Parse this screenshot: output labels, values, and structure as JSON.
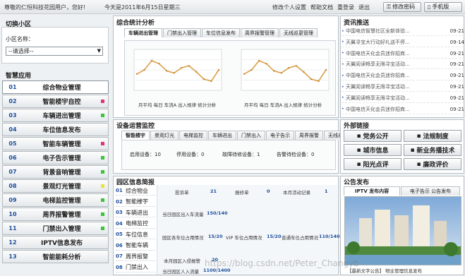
{
  "topbar": {
    "welcome": "尊敬的仁恒科技花园用户，您好!",
    "date": "今天是2011年6月15日星期三",
    "links": [
      "修改个人设置",
      "帮助文档",
      "重登录",
      "退出"
    ],
    "btn_password": "修改密码",
    "btn_mobile": "手机版"
  },
  "left": {
    "title_switch": "切换小区",
    "community_label": "小区名称：",
    "community_select": "--请选择--",
    "title_apps": "智慧应用",
    "menu": [
      {
        "num": "01",
        "label": "综合物业管理",
        "dot": ""
      },
      {
        "num": "02",
        "label": "智能楼宇自控",
        "dot": "#e0337a"
      },
      {
        "num": "03",
        "label": "车辆进出管理",
        "dot": "#39c43a"
      },
      {
        "num": "04",
        "label": "车位信息发布",
        "dot": ""
      },
      {
        "num": "05",
        "label": "智能车辆管理",
        "dot": "#e0337a"
      },
      {
        "num": "06",
        "label": "电子告示管理",
        "dot": "#39c43a"
      },
      {
        "num": "07",
        "label": "背景音响管理",
        "dot": "#39c43a"
      },
      {
        "num": "08",
        "label": "景观灯光管理",
        "dot": "#e8e23a"
      },
      {
        "num": "09",
        "label": "电梯监控管理",
        "dot": "#39c43a"
      },
      {
        "num": "10",
        "label": "周界报警管理",
        "dot": "#39c43a"
      },
      {
        "num": "11",
        "label": "门禁出入管理",
        "dot": "#39c43a"
      },
      {
        "num": "12",
        "label": "IPTV信息发布",
        "dot": ""
      },
      {
        "num": "13",
        "label": "智能能耗分析",
        "dot": ""
      }
    ]
  },
  "stats": {
    "title": "综合统计分析",
    "tabs": [
      "车辆进出管理",
      "门禁出入管理",
      "车位信息发布",
      "周界报警管理",
      "无线巡更管理"
    ],
    "captions": [
      "月平均 每日 车流A 出入规律 统计分析",
      "月平均 每日 车流A 出入规律 统计分析"
    ]
  },
  "devices": {
    "title": "设备运营监控",
    "tabs": [
      "智能楼宇",
      "景观灯光",
      "电梯监控",
      "车辆进出",
      "门禁出入",
      "电子告示",
      "周界报警",
      "无线巡更"
    ],
    "row": [
      {
        "label": "启用设备：",
        "value": "10"
      },
      {
        "label": "停用设备：",
        "value": "0"
      },
      {
        "label": "故障待修设备：",
        "value": "1"
      },
      {
        "label": "告警待检设备：",
        "value": "0"
      }
    ]
  },
  "briefs": {
    "title": "园区信息简报",
    "rows": [
      {
        "num": "01",
        "label": "综合物业"
      },
      {
        "num": "02",
        "label": "智能楼宇"
      },
      {
        "num": "03",
        "label": "车辆进出"
      },
      {
        "num": "04",
        "label": "电梯监控"
      },
      {
        "num": "05",
        "label": "车位信息"
      },
      {
        "num": "06",
        "label": "智能车辆"
      },
      {
        "num": "07",
        "label": "周界报警"
      },
      {
        "num": "08",
        "label": "门禁出入"
      }
    ],
    "stats": {
      "s1": "投诉单",
      "v1": "21",
      "s2": "报修单",
      "v2": "0",
      "s3": "本月活动记录",
      "v3": "1",
      "s4": "当日园区出入车流量",
      "v4": "150/140",
      "s5": "园区各车位占用情况",
      "v5": "15/20",
      "s6": "VIP 车位占用情况",
      "v6": "15/20",
      "s7": "普通车位占用情况",
      "v7": "110/140",
      "s8": "本月园区入侵报警",
      "v8": "20",
      "s9": "当日园区人入流量",
      "v9": "1100/1400"
    }
  },
  "news": {
    "title": "资讯推送",
    "items": [
      {
        "text": "中国电信智慧社区全新体验...",
        "date": "09-21"
      },
      {
        "text": "天翼寻宝大行动好礼送不停...",
        "date": "09-14"
      },
      {
        "text": "中国电信天化会员迷你招商...",
        "date": "09-21"
      },
      {
        "text": "天翼阅读畅享无限寻宝活动...",
        "date": "09-21"
      },
      {
        "text": "中国电信天化会员迷你招商...",
        "date": "09-21"
      },
      {
        "text": "天翼阅读畅享无限寻宝活动...",
        "date": "09-21"
      },
      {
        "text": "天翼阅读畅享无限寻宝活动...",
        "date": "09-21"
      },
      {
        "text": "中国电信天化会员迷你招商...",
        "date": "09-21"
      }
    ]
  },
  "links": {
    "title": "外部链接",
    "items": [
      "党务公开",
      "法规制度",
      "城市信息",
      "新业务播技术",
      "阳光点评",
      "廉政评价"
    ]
  },
  "publish": {
    "title": "公告发布",
    "tabs": [
      "IPTV 发布内容",
      "电子告示 公告发布"
    ],
    "caption": "【最新文字公告】 物业管理信息发布"
  },
  "watermark": "https://blog.csdn.net/Peter_Changyb",
  "chart_data": {
    "type": "line",
    "title": "",
    "series": [
      {
        "values": [
          32,
          40,
          58,
          52,
          38,
          34,
          44,
          48,
          36,
          22,
          18,
          40
        ]
      }
    ],
    "ylim": [
      0,
      80
    ]
  }
}
